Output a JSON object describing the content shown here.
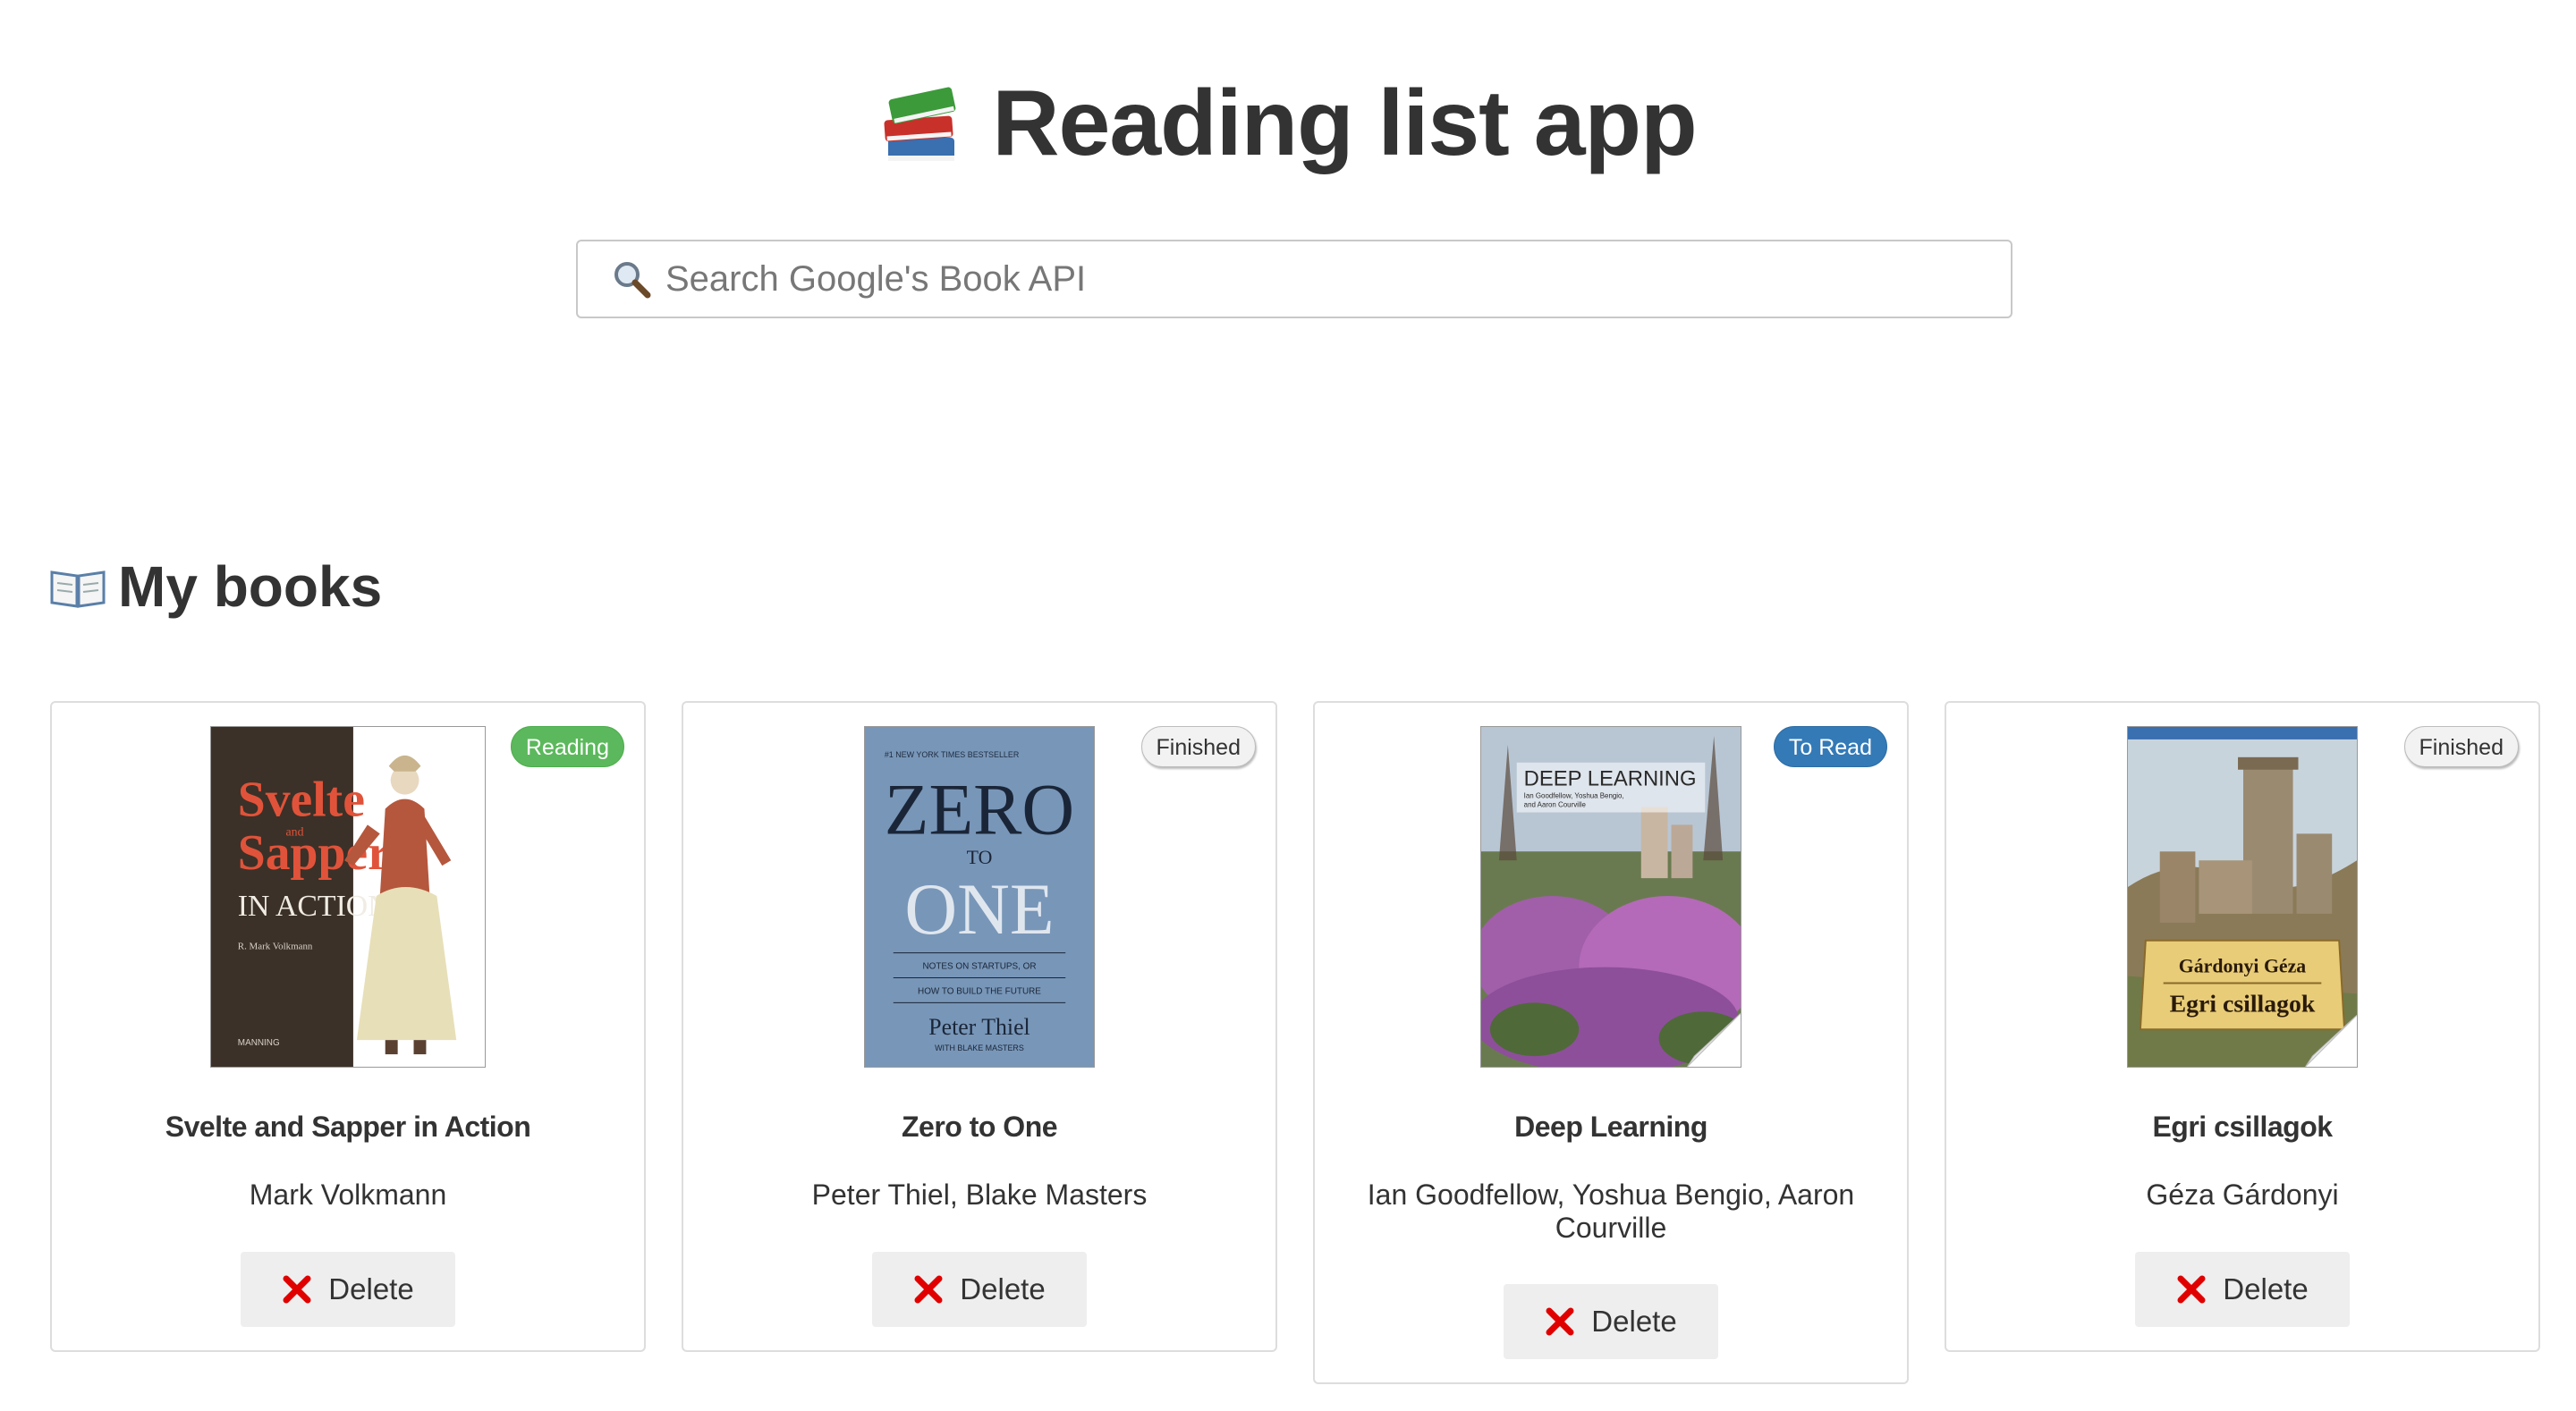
{
  "header": {
    "title": "Reading list app",
    "icon": "books-icon"
  },
  "search": {
    "placeholder": "Search Google's Book API",
    "value": "",
    "icon": "search-icon"
  },
  "my_books": {
    "title": "My books",
    "icon": "open-book-icon",
    "books": [
      {
        "title": "Svelte and Sapper in Action",
        "authors": "Mark Volkmann",
        "status": "Reading",
        "cover_texts": [
          "Svelte",
          "and",
          "Sapper",
          "IN ACTION",
          "R. Mark Volkmann",
          "MANNING"
        ],
        "delete_label": "Delete"
      },
      {
        "title": "Zero to One",
        "authors": "Peter Thiel, Blake Masters",
        "status": "Finished",
        "cover_texts": [
          "#1 NEW YORK TIMES BESTSELLER",
          "ZERO",
          "TO",
          "ONE",
          "NOTES ON STARTUPS, OR",
          "HOW TO BUILD THE FUTURE",
          "Peter Thiel",
          "WITH BLAKE MASTERS"
        ],
        "delete_label": "Delete"
      },
      {
        "title": "Deep Learning",
        "authors": "Ian Goodfellow, Yoshua Bengio, Aaron Courville",
        "status": "To Read",
        "cover_texts": [
          "DEEP LEARNING",
          "Ian Goodfellow, Yoshua Bengio,",
          "and Aaron Courville"
        ],
        "delete_label": "Delete"
      },
      {
        "title": "Egri csillagok",
        "authors": "Géza Gárdonyi",
        "status": "Finished",
        "cover_texts": [
          "Gárdonyi Géza",
          "Egri csillagok"
        ],
        "delete_label": "Delete"
      }
    ]
  },
  "colors": {
    "reading_badge": "#5cb85c",
    "to_read_badge": "#337ab7",
    "finished_badge": "#f2f2f2",
    "delete_icon": "#e00000"
  }
}
